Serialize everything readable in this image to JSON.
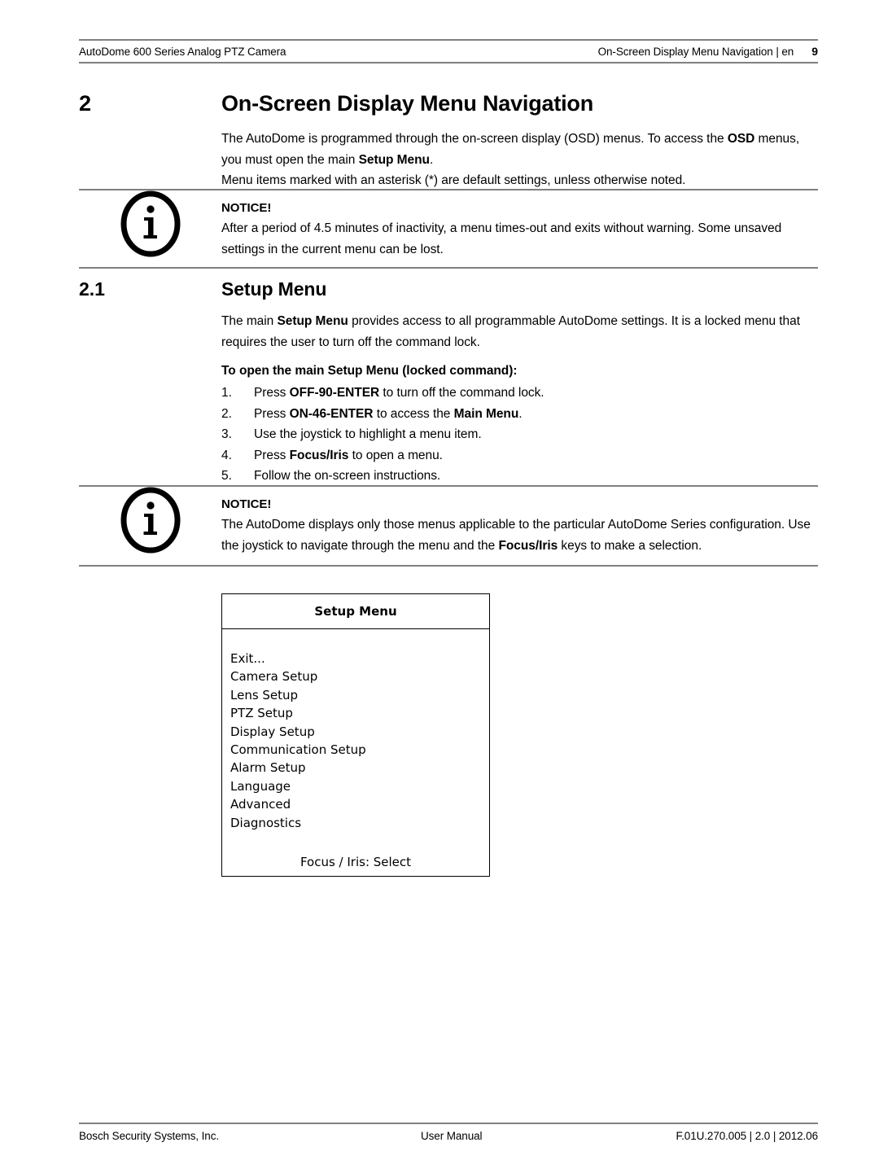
{
  "header": {
    "left": "AutoDome 600 Series Analog PTZ Camera",
    "breadcrumb": "On-Screen Display Menu Navigation | en",
    "page_number": "9"
  },
  "chapter": {
    "number": "2",
    "title": "On-Screen Display Menu Navigation"
  },
  "intro": {
    "line1_a": "The AutoDome is programmed through the on-screen display (OSD) menus. To access the ",
    "line1_b": "OSD",
    "line1_c": " menus, you must open the main ",
    "line1_d": "Setup Menu",
    "line1_e": ".",
    "line2": "Menu items marked with an asterisk (*) are default settings, unless otherwise noted."
  },
  "notice_1": {
    "title": "NOTICE!",
    "text": "After a period of 4.5 minutes of inactivity, a menu times-out and exits without warning. Some unsaved settings in the current menu can be lost.",
    "icon": "info-circle-icon"
  },
  "section": {
    "number": "2.1",
    "title": "Setup Menu"
  },
  "section_body": {
    "p1_a": "The main ",
    "p1_b": "Setup Menu",
    "p1_c": " provides access to all programmable AutoDome settings. It is a locked menu that requires the user to turn off the command lock.",
    "subheading": "To open the main Setup Menu (locked command):"
  },
  "steps": [
    {
      "number": "1.",
      "pre": "Press ",
      "bold": "OFF-90-ENTER",
      "post": " to turn off the command lock.",
      "bold2": "",
      "post2": ""
    },
    {
      "number": "2.",
      "pre": "Press ",
      "bold": "ON-46-ENTER",
      "post": " to access the ",
      "bold2": "Main Menu",
      "post2": "."
    },
    {
      "number": "3.",
      "pre": "Use the joystick to highlight a menu item.",
      "bold": "",
      "post": "",
      "bold2": "",
      "post2": ""
    },
    {
      "number": "4.",
      "pre": "Press ",
      "bold": "Focus/Iris",
      "post": " to open a menu.",
      "bold2": "",
      "post2": ""
    },
    {
      "number": "5.",
      "pre": "Follow the on-screen instructions.",
      "bold": "",
      "post": "",
      "bold2": "",
      "post2": ""
    }
  ],
  "notice_2": {
    "title": "NOTICE!",
    "text_a": "The AutoDome displays only those menus applicable to the particular AutoDome Series configuration. Use the joystick to navigate through the menu and the ",
    "text_b": "Focus/Iris",
    "text_c": " keys to make a selection.",
    "icon": "info-circle-icon"
  },
  "osd_menu": {
    "title": "Setup Menu",
    "items": [
      "Exit...",
      "Camera Setup",
      "Lens Setup",
      "PTZ Setup",
      "Display Setup",
      "Communication Setup",
      "Alarm Setup",
      "Language",
      "Advanced",
      "Diagnostics"
    ],
    "footer": "Focus / Iris: Select"
  },
  "footer": {
    "left": "Bosch Security Systems, Inc.",
    "center": "User Manual",
    "right": "F.01U.270.005 | 2.0 | 2012.06"
  },
  "colors": {
    "rule": "#808080",
    "text": "#000000",
    "box_border": "#000000"
  }
}
